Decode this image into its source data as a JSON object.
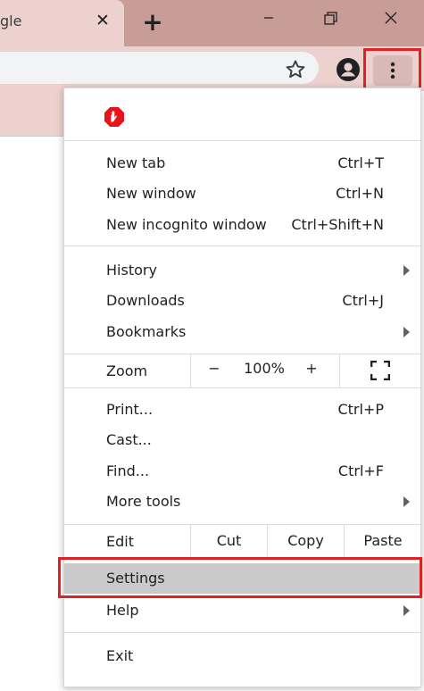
{
  "tab": {
    "title": "gle",
    "close_glyph": "✕"
  },
  "new_tab_glyph": "+",
  "menu": {
    "new_tab": {
      "label": "New tab",
      "shortcut": "Ctrl+T"
    },
    "new_window": {
      "label": "New window",
      "shortcut": "Ctrl+N"
    },
    "new_incognito": {
      "label": "New incognito window",
      "shortcut": "Ctrl+Shift+N"
    },
    "history": {
      "label": "History"
    },
    "downloads": {
      "label": "Downloads",
      "shortcut": "Ctrl+J"
    },
    "bookmarks": {
      "label": "Bookmarks"
    },
    "zoom": {
      "label": "Zoom",
      "minus": "−",
      "value": "100%",
      "plus": "+"
    },
    "print": {
      "label": "Print...",
      "shortcut": "Ctrl+P"
    },
    "cast": {
      "label": "Cast..."
    },
    "find": {
      "label": "Find...",
      "shortcut": "Ctrl+F"
    },
    "more_tools": {
      "label": "More tools"
    },
    "edit": {
      "label": "Edit",
      "cut": "Cut",
      "copy": "Copy",
      "paste": "Paste"
    },
    "settings": {
      "label": "Settings"
    },
    "help": {
      "label": "Help"
    },
    "exit": {
      "label": "Exit"
    }
  },
  "colors": {
    "title_bar": "#c99d97",
    "active_tab": "#ecd1ce",
    "highlight_box": "#e02121",
    "hovered_item": "#cacaca",
    "adblock_icon": "#e8141b"
  }
}
